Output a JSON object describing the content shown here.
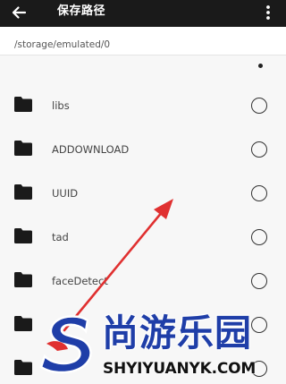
{
  "appbar": {
    "title": "保存路径",
    "back_icon": "arrow-left-icon",
    "more_icon": "more-vertical-icon",
    "background": "#1a1a1a"
  },
  "path": {
    "current": "/storage/emulated/0"
  },
  "folders": [
    {
      "name": "libs",
      "selected": false
    },
    {
      "name": "ADDOWNLOAD",
      "selected": false
    },
    {
      "name": "UUID",
      "selected": false
    },
    {
      "name": "tad",
      "selected": false
    },
    {
      "name": "faceDetect",
      "selected": false
    },
    {
      "name": "",
      "selected": false
    },
    {
      "name": "",
      "selected": false
    }
  ],
  "annotation": {
    "arrow_color": "#e03030"
  },
  "watermark": {
    "text": "尚游乐园",
    "url": "SHYIYUANYK.COM",
    "text_color": "#1f3ea8",
    "logo_colors": [
      "#1f3ea8",
      "#e03030"
    ]
  }
}
